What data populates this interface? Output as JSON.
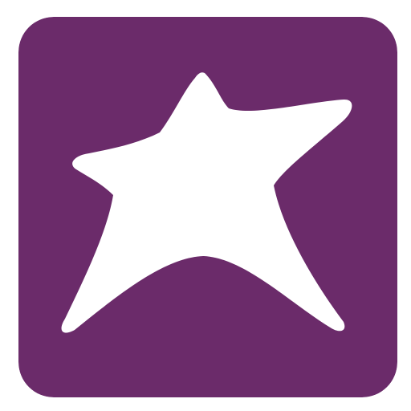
{
  "icon": {
    "name": "star-icon",
    "background_color": "#6b2b6a",
    "foreground_color": "#ffffff"
  }
}
